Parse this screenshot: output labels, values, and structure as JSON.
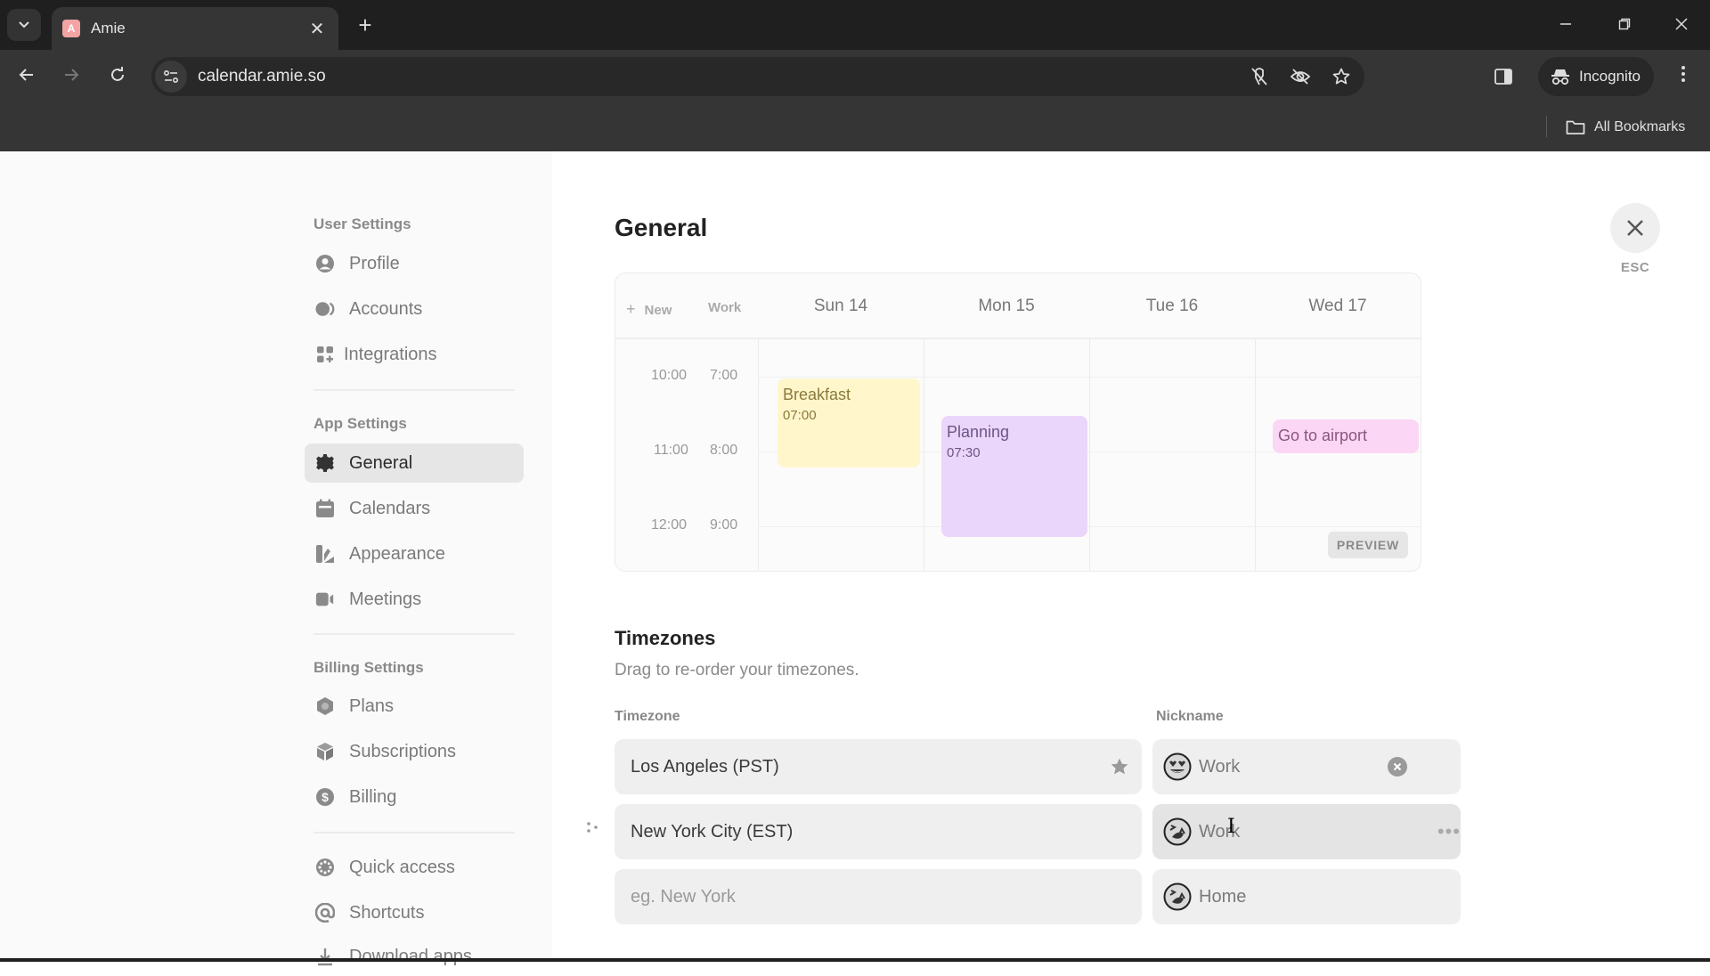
{
  "browser": {
    "tab_title": "Amie",
    "tab_favicon_letter": "A",
    "url": "calendar.amie.so",
    "profile_label": "Incognito",
    "bookmarks_label": "All Bookmarks",
    "tab_close_glyph": "✕",
    "new_tab_glyph": "+",
    "minimize_glyph": "—",
    "restore_glyph": "❐",
    "close_glyph": "✕",
    "back_glyph": "←",
    "forward_glyph": "→",
    "reload_glyph": "↻",
    "menu_glyph": "⋮",
    "tab_search_glyph": "⌄"
  },
  "sidebar": {
    "sections": [
      {
        "title": "User Settings",
        "items": [
          {
            "label": "Profile",
            "icon": "profile-icon"
          },
          {
            "label": "Accounts",
            "icon": "accounts-icon"
          },
          {
            "label": "Integrations",
            "icon": "integrations-icon"
          }
        ]
      },
      {
        "title": "App Settings",
        "items": [
          {
            "label": "General",
            "icon": "gear-icon",
            "active": true
          },
          {
            "label": "Calendars",
            "icon": "calendar-icon"
          },
          {
            "label": "Appearance",
            "icon": "appearance-icon"
          },
          {
            "label": "Meetings",
            "icon": "video-icon"
          }
        ]
      },
      {
        "title": "Billing Settings",
        "items": [
          {
            "label": "Plans",
            "icon": "plans-icon"
          },
          {
            "label": "Subscriptions",
            "icon": "box-icon"
          },
          {
            "label": "Billing",
            "icon": "dollar-icon"
          }
        ]
      },
      {
        "title": "",
        "items": [
          {
            "label": "Quick access",
            "icon": "quick-access-icon"
          },
          {
            "label": "Shortcuts",
            "icon": "at-icon"
          },
          {
            "label": "Download apps",
            "icon": "download-icon"
          }
        ]
      }
    ]
  },
  "main": {
    "title": "General",
    "close_label": "ESC",
    "calendar_preview": {
      "new_label": "New",
      "plus_glyph": "+",
      "tz_label": "Work",
      "days": [
        "Sun 14",
        "Mon 15",
        "Tue 16",
        "Wed 17"
      ],
      "times_primary": [
        "10:00",
        "11:00",
        "12:00"
      ],
      "times_secondary": [
        "7:00",
        "8:00",
        "9:00"
      ],
      "events": [
        {
          "title": "Breakfast",
          "time": "07:00",
          "day": "Sun 14",
          "color": "#fff6cc"
        },
        {
          "title": "Planning",
          "time": "07:30",
          "day": "Mon 15",
          "color": "#ead5fb"
        },
        {
          "title": "Go to airport",
          "time": "",
          "day": "Wed 17",
          "color": "#fcd6f5"
        }
      ],
      "badge": "PREVIEW"
    },
    "timezones": {
      "title": "Timezones",
      "subtitle": "Drag to re-order your timezones.",
      "col_timezone": "Timezone",
      "col_nickname": "Nickname",
      "rows": [
        {
          "timezone": "Los Angeles (PST)",
          "nickname": "Work",
          "emoji": "heart-eyes",
          "primary": true
        },
        {
          "timezone": "New York City (EST)",
          "nickname": "Work",
          "emoji": "laughing"
        },
        {
          "timezone": "",
          "timezone_placeholder": "eg. New York",
          "nickname": "Home",
          "emoji": "laughing"
        }
      ],
      "more_glyph": "•••"
    }
  }
}
